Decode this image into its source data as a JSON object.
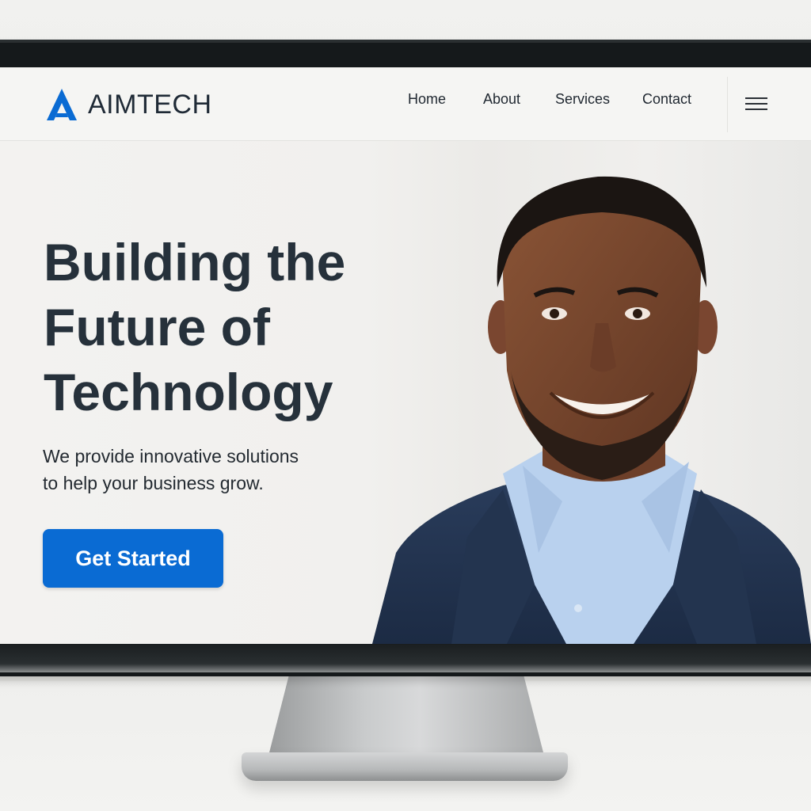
{
  "brand": {
    "name": "AIMTECH",
    "logo_icon": "triangle-a-logo-icon",
    "accent_color": "#0a6bd3"
  },
  "nav": {
    "items": [
      {
        "label": "Home"
      },
      {
        "label": "About"
      },
      {
        "label": "Services"
      },
      {
        "label": "Contact"
      }
    ],
    "menu_icon": "hamburger-menu-icon"
  },
  "hero": {
    "title_lines": [
      "Building the",
      "Future of",
      "Technology"
    ],
    "subtitle_lines": [
      "We provide innovative solutions",
      "to help your business grow."
    ],
    "cta_label": "Get Started",
    "image": "portrait-photo"
  },
  "colors": {
    "title": "#26313b",
    "button": "#0a6bd3"
  }
}
